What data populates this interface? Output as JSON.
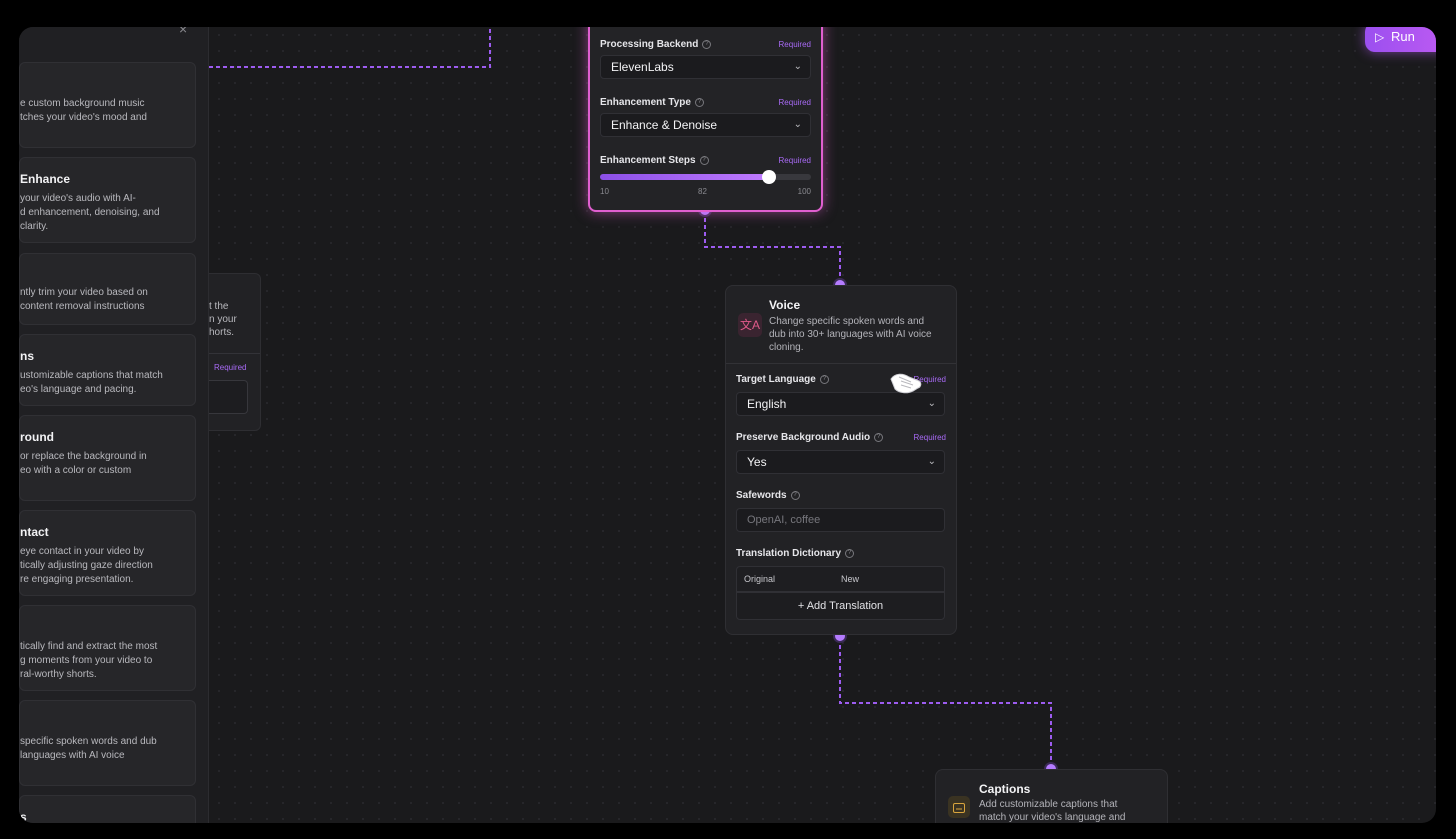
{
  "sidebar": {
    "close_glyph": "×",
    "cards": [
      {
        "title": "",
        "desc": [
          "e custom background music",
          "tches your video's mood and"
        ]
      },
      {
        "title": "Enhance",
        "desc": [
          "your video's audio with AI-",
          "d enhancement, denoising, and",
          "clarity."
        ]
      },
      {
        "title": "",
        "desc": [
          "ntly trim your video based on",
          "content removal instructions"
        ]
      },
      {
        "title": "ns",
        "desc": [
          "ustomizable captions that match",
          "eo's language and pacing."
        ]
      },
      {
        "title": "round",
        "desc": [
          "or replace the background in",
          "eo with a color or custom"
        ]
      },
      {
        "title": "ntact",
        "desc": [
          "eye contact in your video by",
          "tically adjusting gaze direction",
          "re engaging presentation."
        ]
      },
      {
        "title": "",
        "desc": [
          "tically find and extract the most",
          "g moments from your video to",
          "ral-worthy shorts."
        ]
      },
      {
        "title": "",
        "desc": [
          "specific spoken words and dub",
          "languages with AI voice"
        ]
      },
      {
        "title": "s",
        "desc": []
      }
    ]
  },
  "ghost_node": {
    "desc": [
      "t the",
      "n your",
      "horts."
    ],
    "required": "Required"
  },
  "enhance_node": {
    "fields": [
      {
        "label": "Processing Backend",
        "required": "Required",
        "value": "ElevenLabs"
      },
      {
        "label": "Enhancement Type",
        "required": "Required",
        "value": "Enhance & Denoise"
      },
      {
        "label": "Enhancement Steps",
        "required": "Required"
      }
    ],
    "slider": {
      "min": "10",
      "value": "82",
      "max": "100",
      "min_num": 10,
      "value_num": 82,
      "max_num": 100
    }
  },
  "voice_node": {
    "icon": "translate-icon",
    "icon_glyph": "文A",
    "title": "Voice",
    "desc": [
      "Change specific spoken words and",
      "dub into 30+ languages with AI voice",
      "cloning."
    ],
    "target_language": {
      "label": "Target Language",
      "required": "Required",
      "value": "English"
    },
    "preserve_audio": {
      "label": "Preserve Background Audio",
      "required": "Required",
      "value": "Yes"
    },
    "safewords": {
      "label": "Safewords",
      "placeholder": "OpenAI, coffee"
    },
    "dictionary": {
      "label": "Translation Dictionary",
      "col_original": "Original",
      "col_new": "New",
      "add_label": "+ Add Translation"
    }
  },
  "captions_node": {
    "icon": "captions-icon",
    "title": "Captions",
    "desc": [
      "Add customizable captions that",
      "match your video's language and"
    ]
  },
  "toolbar": {
    "run_label": "Run",
    "play_glyph": "▷"
  },
  "glyphs": {
    "chevron": "⌄",
    "help": "?"
  },
  "colors": {
    "accent": "#a86af5",
    "node_glow": "#e05fd0",
    "wire": "#9d5cf0"
  }
}
